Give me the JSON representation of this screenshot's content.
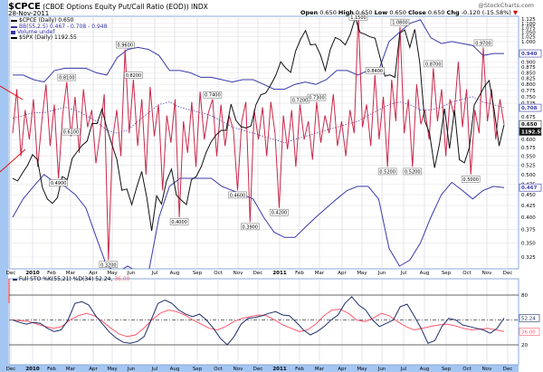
{
  "header": {
    "symbol": "$CPCE",
    "description": "(CBOE Options Equity Put/Call Ratio (EOD)) INDX",
    "date": "28-Nov-2011",
    "watermark": "@StockCharts.com",
    "ohlc": {
      "open_label": "Open",
      "open": "0.650",
      "high_label": "High",
      "high": "0.650",
      "low_label": "Low",
      "low": "0.650",
      "close_label": "Close",
      "close": "0.650",
      "chg_label": "Chg",
      "chg": "-0.120 (-15.58%)"
    }
  },
  "legend": [
    {
      "text": "$CPCE (Daily) 0.650",
      "color": "#000000"
    },
    {
      "text": "BB(55,2.5) 0.467 - 0.708 - 0.948",
      "color": "#3333aa"
    },
    {
      "text": "Volume undef",
      "color": "#3333aa"
    },
    {
      "text": "$SPX (Daily) 1192.55",
      "color": "#000000"
    }
  ],
  "colors": {
    "cpce": "#c8284a",
    "spx": "#111111",
    "bb": "#3a3aaa",
    "k": "#1f2f6a",
    "d": "#ff5a6e",
    "frame": "#a4c6f2"
  },
  "chart_data": [
    {
      "type": "line",
      "title": "$CPCE (CBOE Options Equity Put/Call Ratio (EOD)) INDX",
      "scale": "log",
      "ylim": [
        0.325,
        1.125
      ],
      "y_ticks": [
        "1.125",
        "1.100",
        "1.075",
        "1.050",
        "1.025",
        "1.000",
        "0.900",
        "0.875",
        "0.850",
        "0.825",
        "0.800",
        "0.775",
        "0.750",
        "0.725",
        "0.675",
        "0.600",
        "0.575",
        "0.550",
        "0.525",
        "0.500",
        "0.475",
        "0.450",
        "0.425",
        "0.400",
        "0.375",
        "0.350",
        "0.325"
      ],
      "x_ticks": [
        "Dec",
        "2010",
        "Feb",
        "Mar",
        "Apr",
        "May",
        "Jun",
        "Jul",
        "Aug",
        "Sep",
        "Oct",
        "Nov",
        "Dec",
        "2011",
        "Feb",
        "Mar",
        "Apr",
        "May",
        "Jun",
        "Jul",
        "Aug",
        "Sep",
        "Oct",
        "Nov",
        "Dec"
      ],
      "x_range": [
        "Dec 2009",
        "28-Nov-2011"
      ],
      "right_labels": [
        {
          "text": "0.940",
          "value": 0.94,
          "kind": "bb"
        },
        {
          "text": "0.708",
          "value": 0.708,
          "kind": "bb"
        },
        {
          "text": "0.650",
          "value": 0.65,
          "kind": "price"
        },
        {
          "text": "1192.55",
          "value": 0.625,
          "kind": "dark"
        },
        {
          "text": "0.467",
          "value": 0.467,
          "kind": "bb"
        }
      ],
      "series": [
        {
          "name": "$CPCE",
          "values": [
            0.62,
            0.78,
            0.55,
            0.7,
            0.6,
            0.74,
            0.52,
            0.66,
            0.8,
            0.58,
            0.72,
            0.49,
            0.68,
            0.81,
            0.61,
            0.75,
            0.56,
            0.78,
            0.64,
            0.7,
            0.53,
            0.62,
            0.76,
            0.32,
            0.6,
            0.7,
            0.55,
            0.96,
            0.62,
            0.82,
            0.58,
            0.74,
            0.5,
            0.79,
            0.61,
            0.72,
            0.46,
            0.68,
            0.59,
            0.74,
            0.4,
            0.66,
            0.56,
            0.73,
            0.52,
            0.77,
            0.6,
            0.69,
            0.74,
            0.55,
            0.72,
            0.58,
            0.68,
            0.63,
            0.46,
            0.66,
            0.73,
            0.39,
            0.7,
            0.6,
            0.71,
            0.55,
            0.73,
            0.62,
            0.42,
            0.68,
            0.57,
            0.7,
            0.52,
            0.72,
            0.6,
            0.66,
            0.54,
            0.73,
            0.59,
            0.68,
            0.62,
            0.76,
            0.58,
            0.66,
            0.55,
            0.7,
            0.62,
            1.15,
            0.64,
            0.72,
            0.58,
            0.84,
            0.6,
            0.75,
            0.52,
            0.82,
            0.66,
            1.08,
            0.62,
            0.74,
            0.52,
            0.8,
            0.65,
            0.7,
            0.6,
            0.87,
            0.66,
            0.78,
            0.55,
            0.74,
            0.68,
            0.9,
            0.64,
            0.78,
            0.5,
            0.7,
            0.62,
            0.97,
            0.66,
            0.78,
            0.6,
            0.74,
            0.65
          ]
        },
        {
          "name": "BB upper",
          "values": [
            0.84,
            0.84,
            0.82,
            0.81,
            0.86,
            0.87,
            0.87,
            0.87,
            0.85,
            0.84,
            0.92,
            0.96,
            0.97,
            0.96,
            0.93,
            0.86,
            0.86,
            0.85,
            0.83,
            0.83,
            0.82,
            0.81,
            0.82,
            0.82,
            0.8,
            0.78,
            0.78,
            0.8,
            0.81,
            0.8,
            0.82,
            0.86,
            0.86,
            0.84,
            0.86,
            0.86,
            1.0,
            1.05,
            1.1,
            1.12,
            1.02,
            0.99,
            1.0,
            0.99,
            0.98,
            0.93,
            0.94,
            0.94
          ]
        },
        {
          "name": "BB middle",
          "values": [
            0.67,
            0.68,
            0.69,
            0.69,
            0.7,
            0.71,
            0.7,
            0.68,
            0.66,
            0.63,
            0.62,
            0.63,
            0.66,
            0.69,
            0.72,
            0.73,
            0.71,
            0.7,
            0.69,
            0.68,
            0.66,
            0.64,
            0.63,
            0.62,
            0.61,
            0.6,
            0.59,
            0.6,
            0.61,
            0.62,
            0.63,
            0.64,
            0.65,
            0.66,
            0.68,
            0.7,
            0.72,
            0.73,
            0.72,
            0.7,
            0.7,
            0.71,
            0.73,
            0.74,
            0.75,
            0.73,
            0.72,
            0.708
          ]
        },
        {
          "name": "BB lower",
          "values": [
            0.4,
            0.44,
            0.47,
            0.5,
            0.48,
            0.47,
            0.45,
            0.42,
            0.36,
            0.31,
            0.3,
            0.31,
            0.3,
            0.3,
            0.4,
            0.47,
            0.49,
            0.49,
            0.49,
            0.49,
            0.47,
            0.46,
            0.45,
            0.44,
            0.4,
            0.37,
            0.36,
            0.36,
            0.38,
            0.4,
            0.42,
            0.44,
            0.46,
            0.47,
            0.47,
            0.44,
            0.34,
            0.31,
            0.32,
            0.35,
            0.4,
            0.45,
            0.48,
            0.46,
            0.44,
            0.46,
            0.47,
            0.467
          ]
        },
        {
          "name": "$SPX",
          "range": [
            1022,
            1363
          ],
          "values": [
            1106,
            1102,
            1115,
            1127,
            1144,
            1136,
            1091,
            1073,
            1066,
            1075,
            1109,
            1104,
            1138,
            1149,
            1159,
            1166,
            1194,
            1194,
            1217,
            1186,
            1160,
            1136,
            1087,
            1089,
            1064,
            1092,
            1117,
            1076,
            1022,
            1078,
            1065,
            1102,
            1121,
            1079,
            1071,
            1064,
            1104,
            1109,
            1125,
            1148,
            1165,
            1176,
            1183,
            1183,
            1225,
            1199,
            1189,
            1187,
            1190,
            1224,
            1240,
            1243,
            1256,
            1271,
            1293,
            1283,
            1276,
            1310,
            1329,
            1343,
            1320,
            1321,
            1304,
            1279,
            1313,
            1332,
            1328,
            1320,
            1337,
            1363,
            1340,
            1337,
            1333,
            1331,
            1300,
            1270,
            1272,
            1268,
            1339,
            1344,
            1316,
            1345,
            1292,
            1199,
            1178,
            1123,
            1162,
            1218,
            1154,
            1216,
            1136,
            1131,
            1155,
            1224,
            1238,
            1253,
            1263,
            1216,
            1158,
            1192
          ]
        }
      ],
      "annotations": [
        {
          "text": "0.8100",
          "index": 13,
          "pos": "above"
        },
        {
          "text": "0.4900",
          "index": 11,
          "pos": "below"
        },
        {
          "text": "0.6100",
          "index": 14,
          "pos": "above"
        },
        {
          "text": "0.3200",
          "index": 23,
          "pos": "below"
        },
        {
          "text": "0.9600",
          "index": 27,
          "pos": "above"
        },
        {
          "text": "0.8200",
          "index": 29,
          "pos": "above"
        },
        {
          "text": "0.4000",
          "index": 40,
          "pos": "below"
        },
        {
          "text": "0.7400",
          "index": 48,
          "pos": "above"
        },
        {
          "text": "0.4600",
          "index": 54,
          "pos": "below"
        },
        {
          "text": "0.3900",
          "index": 57,
          "pos": "below"
        },
        {
          "text": "0.4200",
          "index": 64,
          "pos": "below"
        },
        {
          "text": "0.7200",
          "index": 69,
          "pos": "above"
        },
        {
          "text": "0.7300",
          "index": 73,
          "pos": "above"
        },
        {
          "text": "1.1500",
          "index": 83,
          "pos": "above"
        },
        {
          "text": "0.8400",
          "index": 87,
          "pos": "above"
        },
        {
          "text": "0.5200",
          "index": 90,
          "pos": "below"
        },
        {
          "text": "1.0800",
          "index": 93,
          "pos": "above"
        },
        {
          "text": "0.5200",
          "index": 96,
          "pos": "below"
        },
        {
          "text": "0.8700",
          "index": 101,
          "pos": "above"
        },
        {
          "text": "0.5000",
          "index": 110,
          "pos": "below"
        },
        {
          "text": "0.9700",
          "index": 113,
          "pos": "above"
        }
      ]
    },
    {
      "type": "line",
      "title": "Full STO %K(55,21) %D(34) 52.24, 36.00",
      "title_k": "Full STO %K(55,21) %D(34) 52.24,",
      "title_d": "36.00",
      "ylim": [
        0,
        100
      ],
      "y_ticks": [
        "80",
        "20"
      ],
      "ref_line": 50,
      "right_labels": [
        {
          "text": "52.24",
          "value": 52.24,
          "kind": "k"
        },
        {
          "text": "36.00",
          "value": 36,
          "kind": "d"
        }
      ],
      "series": [
        {
          "name": "%K",
          "values": [
            50,
            47,
            45,
            47,
            46,
            40,
            36,
            38,
            50,
            70,
            72,
            68,
            55,
            45,
            35,
            28,
            23,
            22,
            24,
            30,
            50,
            70,
            74,
            70,
            62,
            57,
            54,
            57,
            50,
            40,
            28,
            20,
            30,
            45,
            52,
            53,
            55,
            58,
            60,
            56,
            55,
            47,
            38,
            32,
            36,
            42,
            50,
            56,
            70,
            78,
            68,
            62,
            50,
            42,
            46,
            50,
            66,
            69,
            55,
            40,
            22,
            25,
            42,
            52,
            50,
            44,
            42,
            40,
            38,
            34,
            40,
            52.24
          ]
        },
        {
          "name": "%D",
          "values": [
            50,
            49,
            48,
            45,
            42,
            40,
            42,
            50,
            55,
            58,
            55,
            48,
            40,
            33,
            30,
            32,
            40,
            50,
            58,
            62,
            60,
            56,
            50,
            45,
            40,
            38,
            42,
            48,
            52,
            54,
            56,
            55,
            50,
            44,
            40,
            36,
            38,
            45,
            55,
            62,
            63,
            58,
            50,
            48,
            52,
            58,
            55,
            48,
            42,
            38,
            40,
            42,
            44,
            45,
            43,
            40,
            38,
            39,
            40,
            38,
            36
          ]
        }
      ]
    }
  ]
}
